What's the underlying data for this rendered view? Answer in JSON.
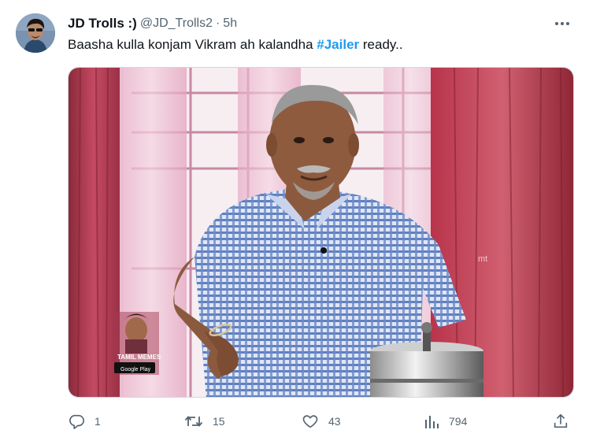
{
  "tweet": {
    "display_name": "JD Trolls :)",
    "handle": "@JD_Trolls2",
    "separator": "·",
    "time": "5h",
    "text_before": "Baasha kulla konjam Vikram ah kalandha ",
    "hashtag": "#Jailer",
    "text_after": " ready..",
    "media": {
      "watermark": "mt",
      "inset_caption": "TAMIL MEMES",
      "inset_badge": "Google Play"
    }
  },
  "actions": {
    "replies": "1",
    "retweets": "15",
    "likes": "43",
    "views": "794"
  },
  "icons": {
    "avatar": "user-avatar",
    "more": "more-horizontal-icon",
    "reply": "reply-bubble-icon",
    "retweet": "retweet-icon",
    "like": "heart-icon",
    "views": "bar-chart-icon",
    "share": "share-upload-icon"
  },
  "colors": {
    "text": "#0f1419",
    "secondary": "#536471",
    "hashtag": "#1d9bf0",
    "border": "#cfd9de"
  }
}
